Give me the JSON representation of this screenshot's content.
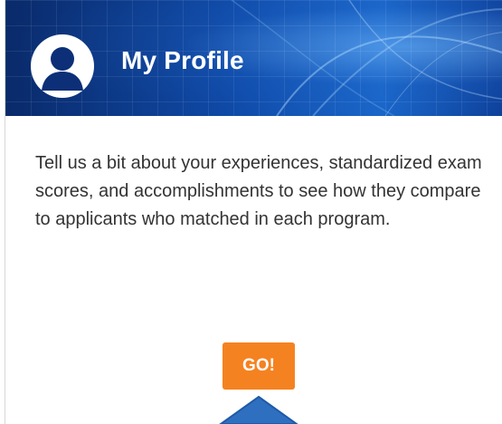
{
  "profile_card": {
    "title": "My Profile",
    "description": "Tell us a bit about your experiences, standardized exam scores, and accomplishments to see how they compare to applicants who matched in each program.",
    "go_label": "GO!",
    "avatar_icon": "user-avatar-icon",
    "pointer_icon": "up-arrow-pointer-icon"
  },
  "colors": {
    "header_blue": "#0f4aa8",
    "go_orange": "#f58220",
    "pointer_blue": "#2f6fc0"
  }
}
